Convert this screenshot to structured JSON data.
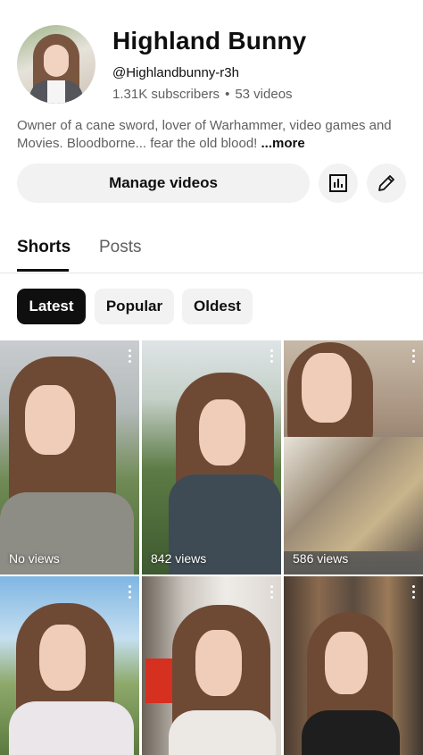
{
  "channel": {
    "name": "Highland Bunny",
    "handle": "@Highlandbunny-r3h",
    "subscribers": "1.31K subscribers",
    "separator": "•",
    "videos": "53 videos",
    "description": "Owner of a cane sword, lover of Warhammer, video games and Movies. Bloodborne... fear the old blood!",
    "more_label": "...more"
  },
  "actions": {
    "manage_label": "Manage videos",
    "analytics_icon": "analytics-icon",
    "edit_icon": "pencil-icon"
  },
  "tabs": [
    {
      "label": "Shorts",
      "selected": true
    },
    {
      "label": "Posts",
      "selected": false
    }
  ],
  "filters": [
    {
      "label": "Latest",
      "selected": true
    },
    {
      "label": "Popular",
      "selected": false
    },
    {
      "label": "Oldest",
      "selected": false
    }
  ],
  "shorts": [
    {
      "views": "No views"
    },
    {
      "views": "842 views"
    },
    {
      "views": "586 views"
    },
    {
      "views": ""
    },
    {
      "views": ""
    },
    {
      "views": ""
    }
  ],
  "colors": {
    "text": "#0f0f0f",
    "secondary": "#606060",
    "chip_bg": "#f2f2f2",
    "selected_chip": "#0f0f0f"
  }
}
